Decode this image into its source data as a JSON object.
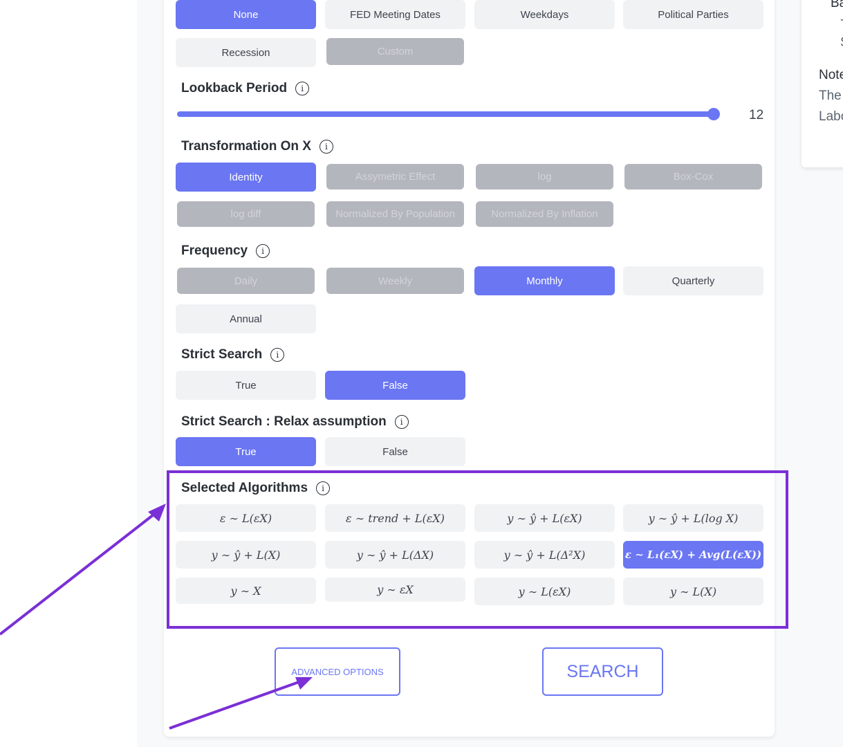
{
  "colors": {
    "accent": "#6a76f2",
    "annotation": "#7b2fd6"
  },
  "events": {
    "options": [
      "None",
      "FED Meeting Dates",
      "Weekdays",
      "Political Parties",
      "Recession",
      "Custom"
    ],
    "selected": "None"
  },
  "lookback": {
    "label": "Lookback Period",
    "value": "12",
    "fraction": 1.0
  },
  "transformation": {
    "label": "Transformation On X",
    "options": [
      "Identity",
      "Assymetric Effect",
      "log",
      "Box-Cox",
      "log diff",
      "Normalized By Population",
      "Normalized By Inflation"
    ],
    "selected": "Identity"
  },
  "frequency": {
    "label": "Frequency",
    "options": [
      "Daily",
      "Weekly",
      "Monthly",
      "Quarterly",
      "Annual"
    ],
    "selected": "Monthly"
  },
  "strict": {
    "label": "Strict Search",
    "options": [
      "True",
      "False"
    ],
    "selected": "False"
  },
  "relax": {
    "label": "Strict Search : Relax assumption",
    "options": [
      "True",
      "False"
    ],
    "selected": "True"
  },
  "algorithms": {
    "label": "Selected Algorithms",
    "options": [
      "ε ∼ L(εX)",
      "ε ∼ trend + L(εX)",
      "y ∼ ŷ + L(εX)",
      "y ∼ ŷ + L(log X)",
      "y ∼ ŷ + L(X)",
      "y ∼ ŷ + L(ΔX)",
      "y ∼ ŷ + L(Δ²X)",
      "ε ∼ L₁(εX) + Avg(L(εX))",
      "y ∼ X",
      "y ∼ εX",
      "y ∼ L(εX)",
      "y ∼ L(X)"
    ],
    "selected": "ε ∼ L₁(εX) + Avg(L(εX))"
  },
  "actions": {
    "advanced": "ADVANCED OPTIONS",
    "search": "SEARCH"
  },
  "side_panel": {
    "lines": [
      "Ba",
      "-",
      "S",
      "Note",
      "The",
      "Labo"
    ]
  }
}
